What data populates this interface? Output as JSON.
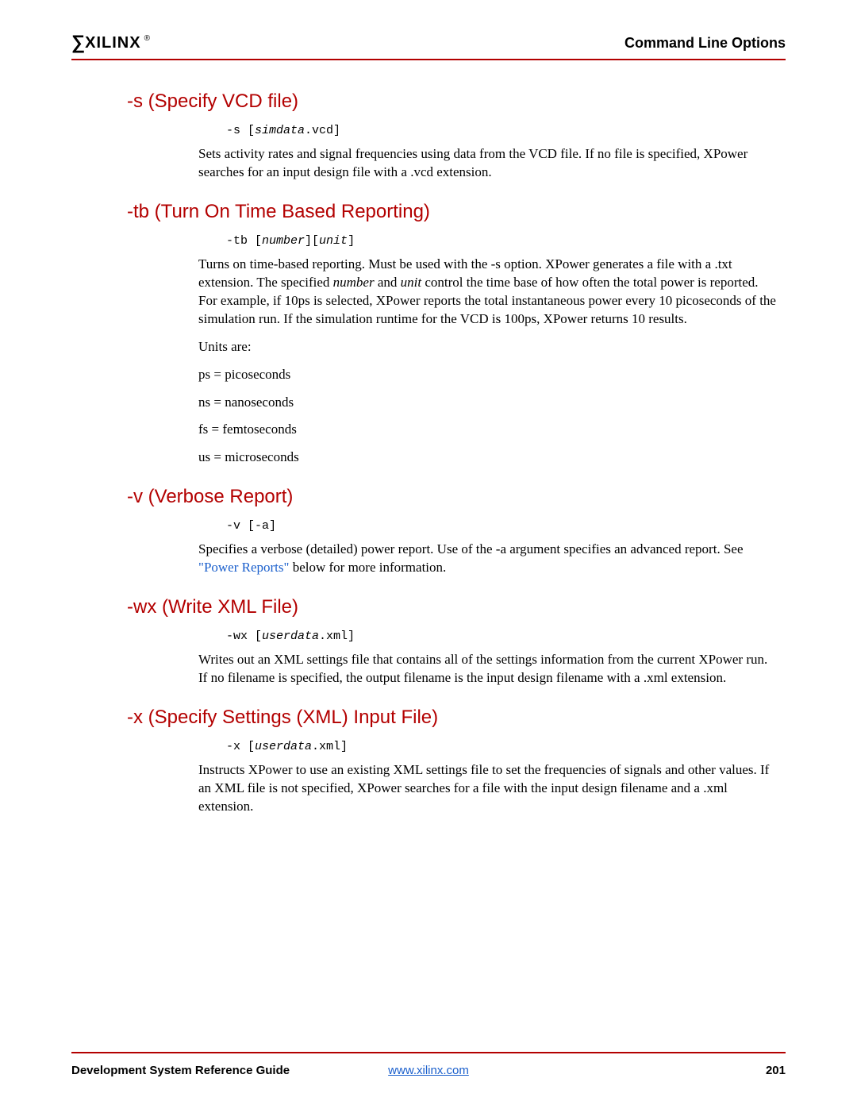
{
  "header": {
    "logo_text": "XILINX",
    "logo_reg": "®",
    "title": "Command Line Options"
  },
  "sections": {
    "s": {
      "heading": "-s (Specify VCD file)",
      "code_pre": "-s [",
      "code_ital": "simdata",
      "code_post": ".vcd]",
      "p1": "Sets activity rates and signal frequencies using data from the VCD file. If no file is specified, XPower searches for an input design file with a .vcd extension."
    },
    "tb": {
      "heading": "-tb (Turn On Time Based Reporting)",
      "code_pre": "-tb [",
      "code_ital1": "number",
      "code_mid": "][",
      "code_ital2": "unit",
      "code_post": "]",
      "p1a": "Turns on time-based reporting. Must be used with the -s option. XPower generates a file with a .txt extension. The specified ",
      "p1_num": "number",
      "p1b": " and ",
      "p1_unit": "unit",
      "p1c": " control the time base of how often the total power is reported. For example, if 10ps is selected, XPower reports the total instantaneous power every 10 picoseconds of the simulation run. If the simulation runtime for the VCD is 100ps, XPower returns 10 results.",
      "p2": "Units are:",
      "p3": "ps = picoseconds",
      "p4": "ns = nanoseconds",
      "p5": "fs = femtoseconds",
      "p6": "us = microseconds"
    },
    "v": {
      "heading": "-v (Verbose Report)",
      "code": "-v [-a]",
      "p1a": "Specifies a verbose (detailed) power report. Use of the -a argument specifies an advanced report. See ",
      "p1_link": "\"Power Reports\"",
      "p1b": " below for more information."
    },
    "wx": {
      "heading": "-wx (Write XML File)",
      "code_pre": "-wx [",
      "code_ital": "userdata",
      "code_post": ".xml]",
      "p1": "Writes out an XML settings file that contains all of the settings information from the current XPower run. If no filename is specified, the output filename is the input design filename with a .xml extension."
    },
    "x": {
      "heading": "-x (Specify Settings (XML) Input File)",
      "code_pre": "-x [",
      "code_ital": "userdata",
      "code_post": ".xml]",
      "p1": "Instructs XPower to use an existing XML settings file to set the frequencies of signals and other values. If an XML file is not specified, XPower searches for a file with the input design filename and a .xml extension."
    }
  },
  "footer": {
    "left": "Development System Reference Guide",
    "center": "www.xilinx.com",
    "right": "201"
  }
}
